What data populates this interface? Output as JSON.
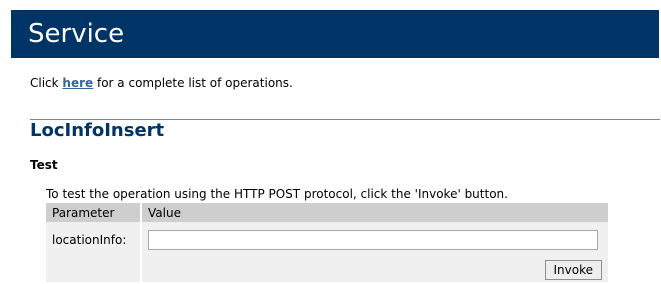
{
  "banner": {
    "title": "Service"
  },
  "intro": {
    "prefix": "Click ",
    "link_text": "here",
    "suffix": " for a complete list of operations."
  },
  "operation": {
    "name": "LocInfoInsert",
    "section_heading": "Test",
    "description": "To test the operation using the HTTP POST protocol, click the 'Invoke' button."
  },
  "form": {
    "columns": [
      "Parameter",
      "Value"
    ],
    "parameters": [
      {
        "name": "locationInfo:",
        "value": ""
      }
    ],
    "invoke_label": "Invoke"
  },
  "colors": {
    "banner_bg": "#003366",
    "title_color": "#003366",
    "link_color": "#336699",
    "table_header_bg": "#cecece",
    "table_cell_bg": "#f0f0f0"
  }
}
